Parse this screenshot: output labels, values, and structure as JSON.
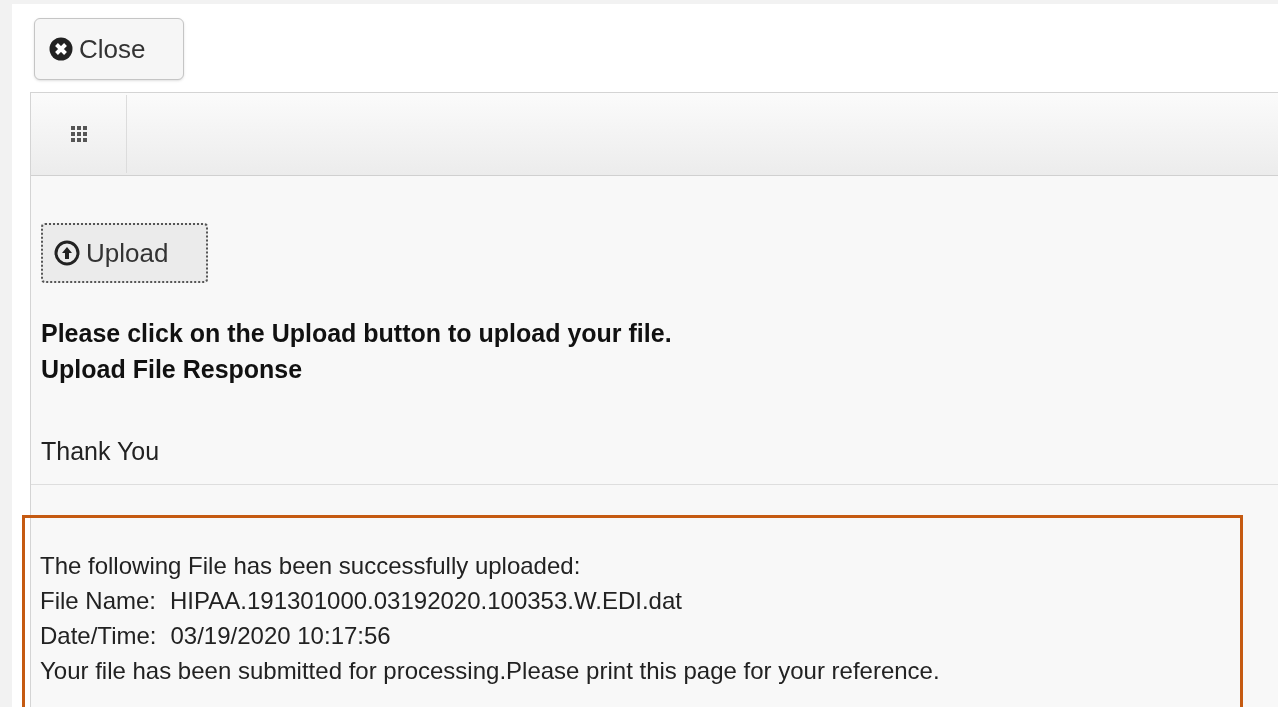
{
  "close_button": {
    "label": "Close"
  },
  "upload_button": {
    "label": "Upload",
    "focused": true
  },
  "instructions": [
    "Please click on the Upload button to upload your file.",
    "Upload File Response"
  ],
  "thank_you": "Thank You",
  "response": {
    "heading": "The following File has been successfully uploaded:",
    "fields": [
      {
        "label": "File Name:",
        "value": "HIPAA.191301000.03192020.100353.W.EDI.dat"
      },
      {
        "label": "Date/Time:",
        "value": "03/19/2020 10:17:56"
      }
    ],
    "note": "Your file has been submitted for processing.Please print this page for your reference."
  }
}
